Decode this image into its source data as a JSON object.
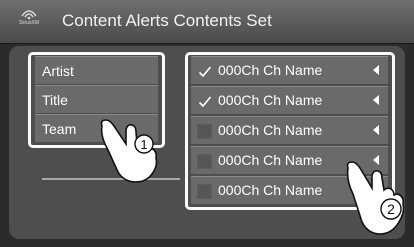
{
  "header": {
    "logo_text": "SiriusXM",
    "title": "Content Alerts Contents Set"
  },
  "left_list": {
    "items": [
      {
        "label": "Artist"
      },
      {
        "label": "Title"
      },
      {
        "label": "Team"
      }
    ]
  },
  "channel_list": {
    "items": [
      {
        "label": "000Ch Ch Name",
        "checked": true,
        "has_arrow": true
      },
      {
        "label": "000Ch Ch Name",
        "checked": true,
        "has_arrow": true
      },
      {
        "label": "000Ch Ch Name",
        "checked": false,
        "has_arrow": true
      },
      {
        "label": "000Ch Ch Name",
        "checked": false,
        "has_arrow": true
      },
      {
        "label": "000Ch Ch Name",
        "checked": false,
        "has_arrow": false
      }
    ]
  },
  "callouts": {
    "step1": "1",
    "step2": "2"
  },
  "colors": {
    "background": "#2b2b2b",
    "panel": "#4e4e4e",
    "row": "#6a6a6a",
    "highlight_frame": "#fafafa"
  },
  "icons": {
    "logo": "siriusxm-logo-icon",
    "check": "check-icon",
    "arrow": "left-arrow-icon",
    "hand": "pointing-hand-icon"
  }
}
